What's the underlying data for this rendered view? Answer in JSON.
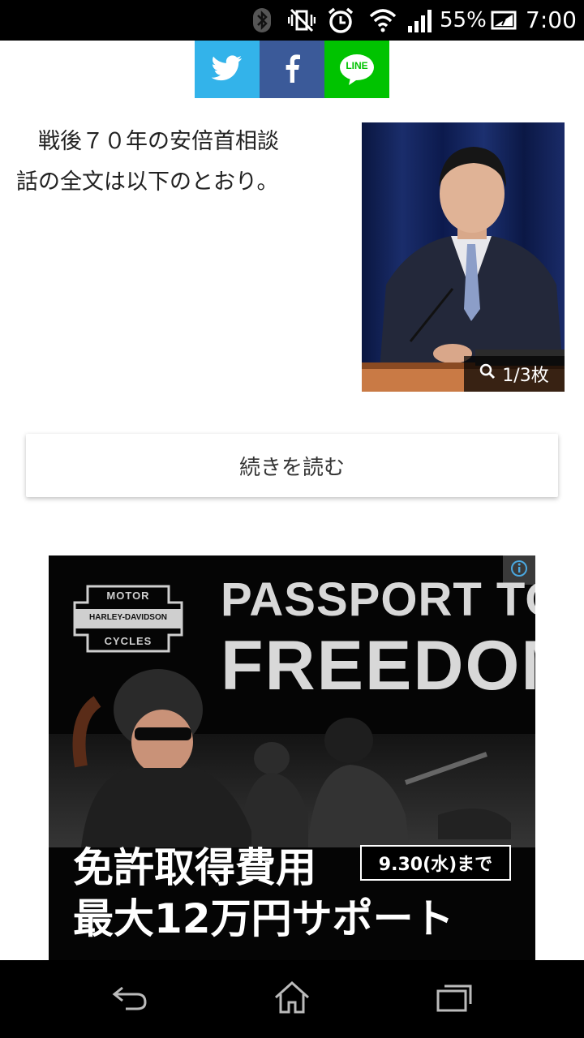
{
  "status_bar": {
    "battery": "55%",
    "time": "7:00",
    "icons": [
      "bluetooth-icon",
      "vibrate-off-icon",
      "alarm-icon",
      "wifi-icon",
      "signal-icon",
      "battery-icon"
    ]
  },
  "share": {
    "buttons": [
      {
        "name": "twitter",
        "icon": "twitter-icon",
        "color": "#33b3ea"
      },
      {
        "name": "facebook",
        "icon": "facebook-icon",
        "color": "#3b5a99"
      },
      {
        "name": "line",
        "icon": "line-icon",
        "color": "#00c300",
        "label": "LINE"
      }
    ]
  },
  "article": {
    "line1": "　戦後７０年の安倍首相談",
    "line2": "話の全文は以下のとおり。",
    "photo_counter": "1/3枚"
  },
  "read_more": {
    "label": "続きを読む"
  },
  "ad": {
    "brand_top": "MOTOR",
    "brand_middle": "HARLEY-DAVIDSON",
    "brand_bottom": "CYCLES",
    "headline_1": "PASSPORT TO",
    "headline_2": "FREEDOM",
    "copy_1": "免許取得費用",
    "copy_2": "最大12万円サポート",
    "date": "9.30(水)まで",
    "info_icon": "info-icon"
  },
  "nav_bar": {
    "buttons": [
      "back-icon",
      "home-icon",
      "recents-icon"
    ]
  },
  "colors": {
    "twitter": "#33b3ea",
    "facebook": "#3b5a99",
    "line": "#00c300"
  }
}
